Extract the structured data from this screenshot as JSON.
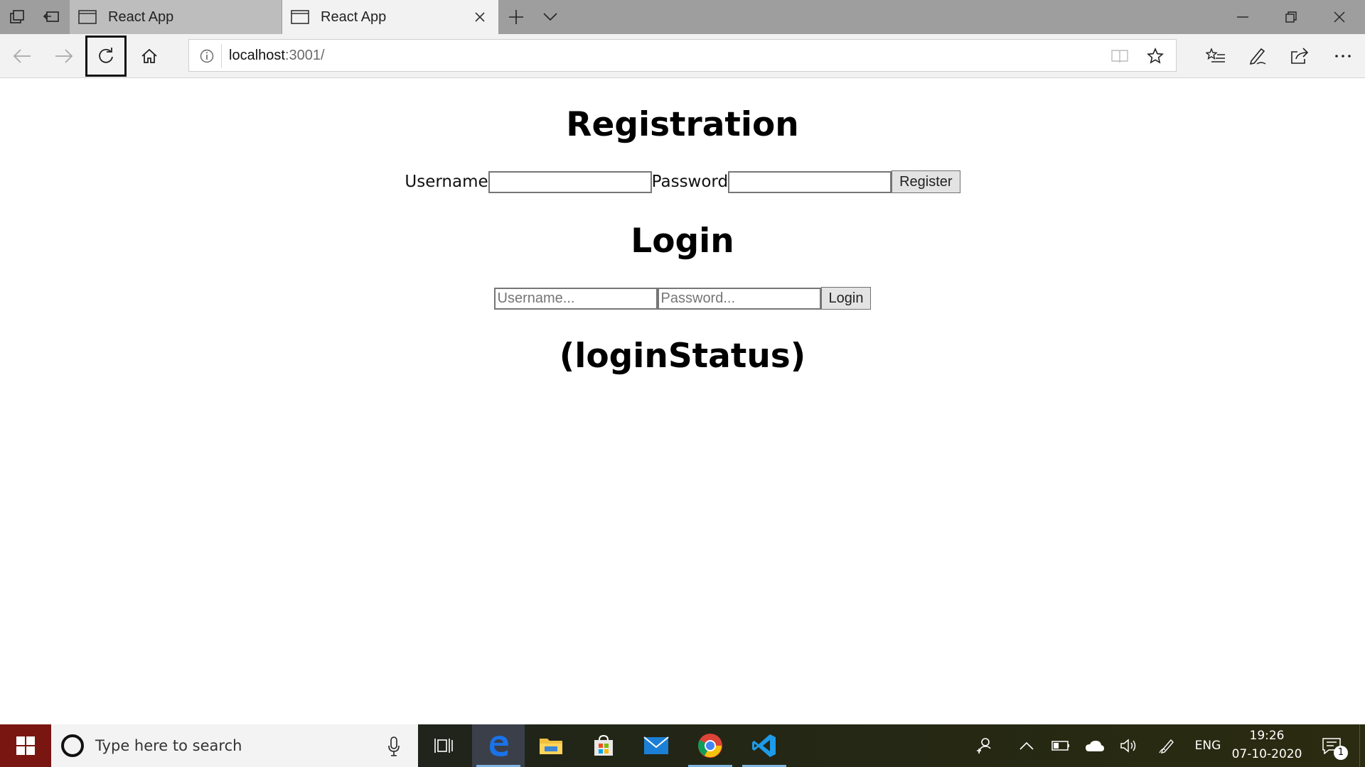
{
  "browser": {
    "tabs": [
      {
        "title": "React App",
        "active": false
      },
      {
        "title": "React App",
        "active": true
      }
    ],
    "address": {
      "host": "localhost",
      "rest": ":3001/"
    },
    "icons": {
      "set_aside": "tabs-aside-icon",
      "restore_tabs": "restore-tabs-icon",
      "page": "page-icon",
      "close": "close-icon",
      "new_tab": "plus-icon",
      "tab_list": "chevron-down-icon",
      "back": "back-arrow-icon",
      "forward": "forward-arrow-icon",
      "refresh": "refresh-icon",
      "home": "home-icon",
      "info": "info-icon",
      "reading_view": "book-icon",
      "favorite": "star-icon",
      "favorites_hub": "favorites-list-icon",
      "notes": "pen-icon",
      "share": "share-icon",
      "more": "ellipsis-icon"
    }
  },
  "page": {
    "registration": {
      "heading": "Registration",
      "username_label": "Username",
      "username_value": "",
      "password_label": "Password",
      "password_value": "",
      "button": "Register"
    },
    "login": {
      "heading": "Login",
      "username_placeholder": "Username...",
      "password_placeholder": "Password...",
      "button": "Login"
    },
    "status": "(loginStatus)"
  },
  "taskbar": {
    "search_placeholder": "Type here to search",
    "apps": [
      "task-view-icon",
      "edge-icon",
      "file-explorer-icon",
      "store-icon",
      "mail-icon",
      "chrome-icon",
      "vscode-icon"
    ],
    "language": "ENG",
    "time": "19:26",
    "date": "07-10-2020",
    "notification_count": "1"
  },
  "colors": {
    "tabstrip": "#9e9e9e",
    "active_tab": "#f2f2f2",
    "edge_blue": "#1a73e8",
    "vscode_blue": "#1e9be8",
    "start_red": "#7a1612"
  }
}
